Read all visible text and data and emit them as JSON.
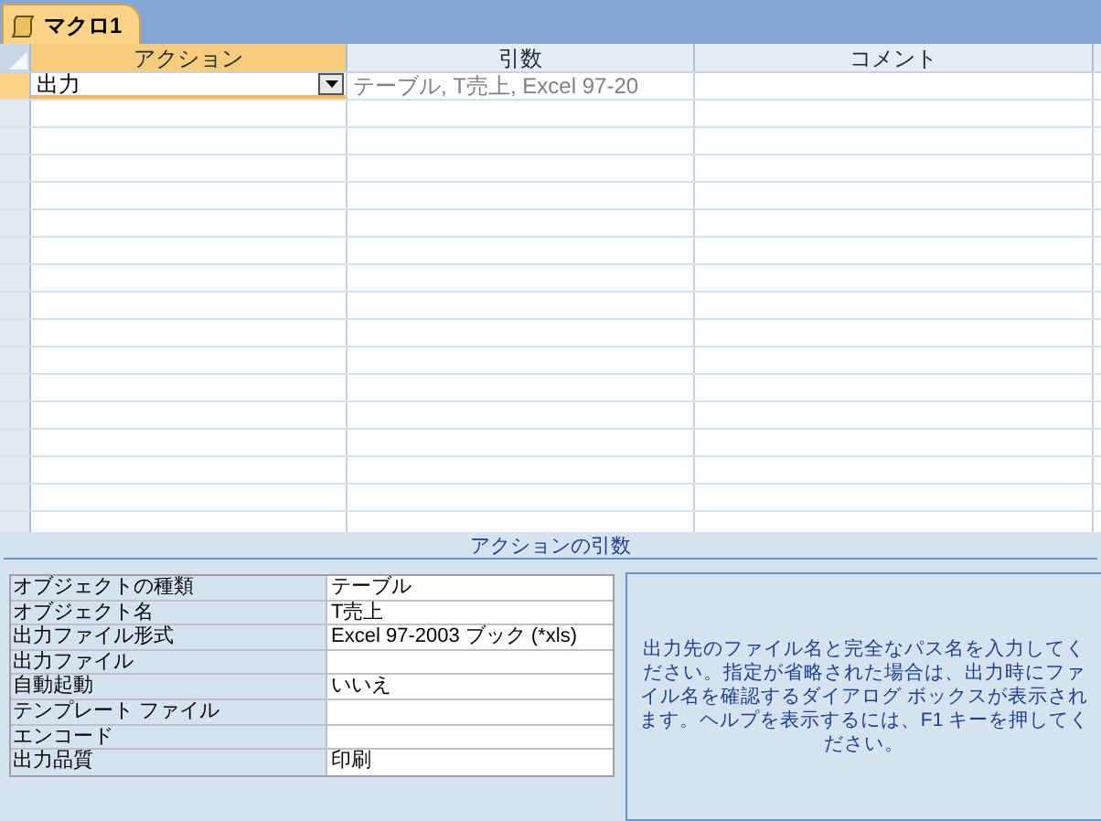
{
  "document_tab": {
    "title": "マクロ1",
    "selected": true
  },
  "grid": {
    "columns": [
      "アクション",
      "引数",
      "コメント"
    ],
    "rows": [
      {
        "action": "出力",
        "arguments": "テーブル, T売上, Excel 97-20",
        "comment": "",
        "selected": true
      }
    ]
  },
  "arguments_panel": {
    "title": "アクションの引数",
    "properties": [
      {
        "label": "オブジェクトの種類",
        "value": "テーブル"
      },
      {
        "label": "オブジェクト名",
        "value": "T売上"
      },
      {
        "label": "出力ファイル形式",
        "value": "Excel 97-2003 ブック (*xls)"
      },
      {
        "label": "出力ファイル"
      },
      {
        "label": "自動起動",
        "value": "いいえ"
      },
      {
        "label": "テンプレート ファイル"
      },
      {
        "label": "エンコード"
      },
      {
        "label": "出力品質",
        "value": "印刷"
      }
    ],
    "help_text": "出力先のファイル名と完全なパス名を入力してください。指定が省略された場合は、出力時にファイル名を確認するダイアログ ボックスが表示されます。ヘルプを表示するには、F1 キーを押してください。"
  }
}
